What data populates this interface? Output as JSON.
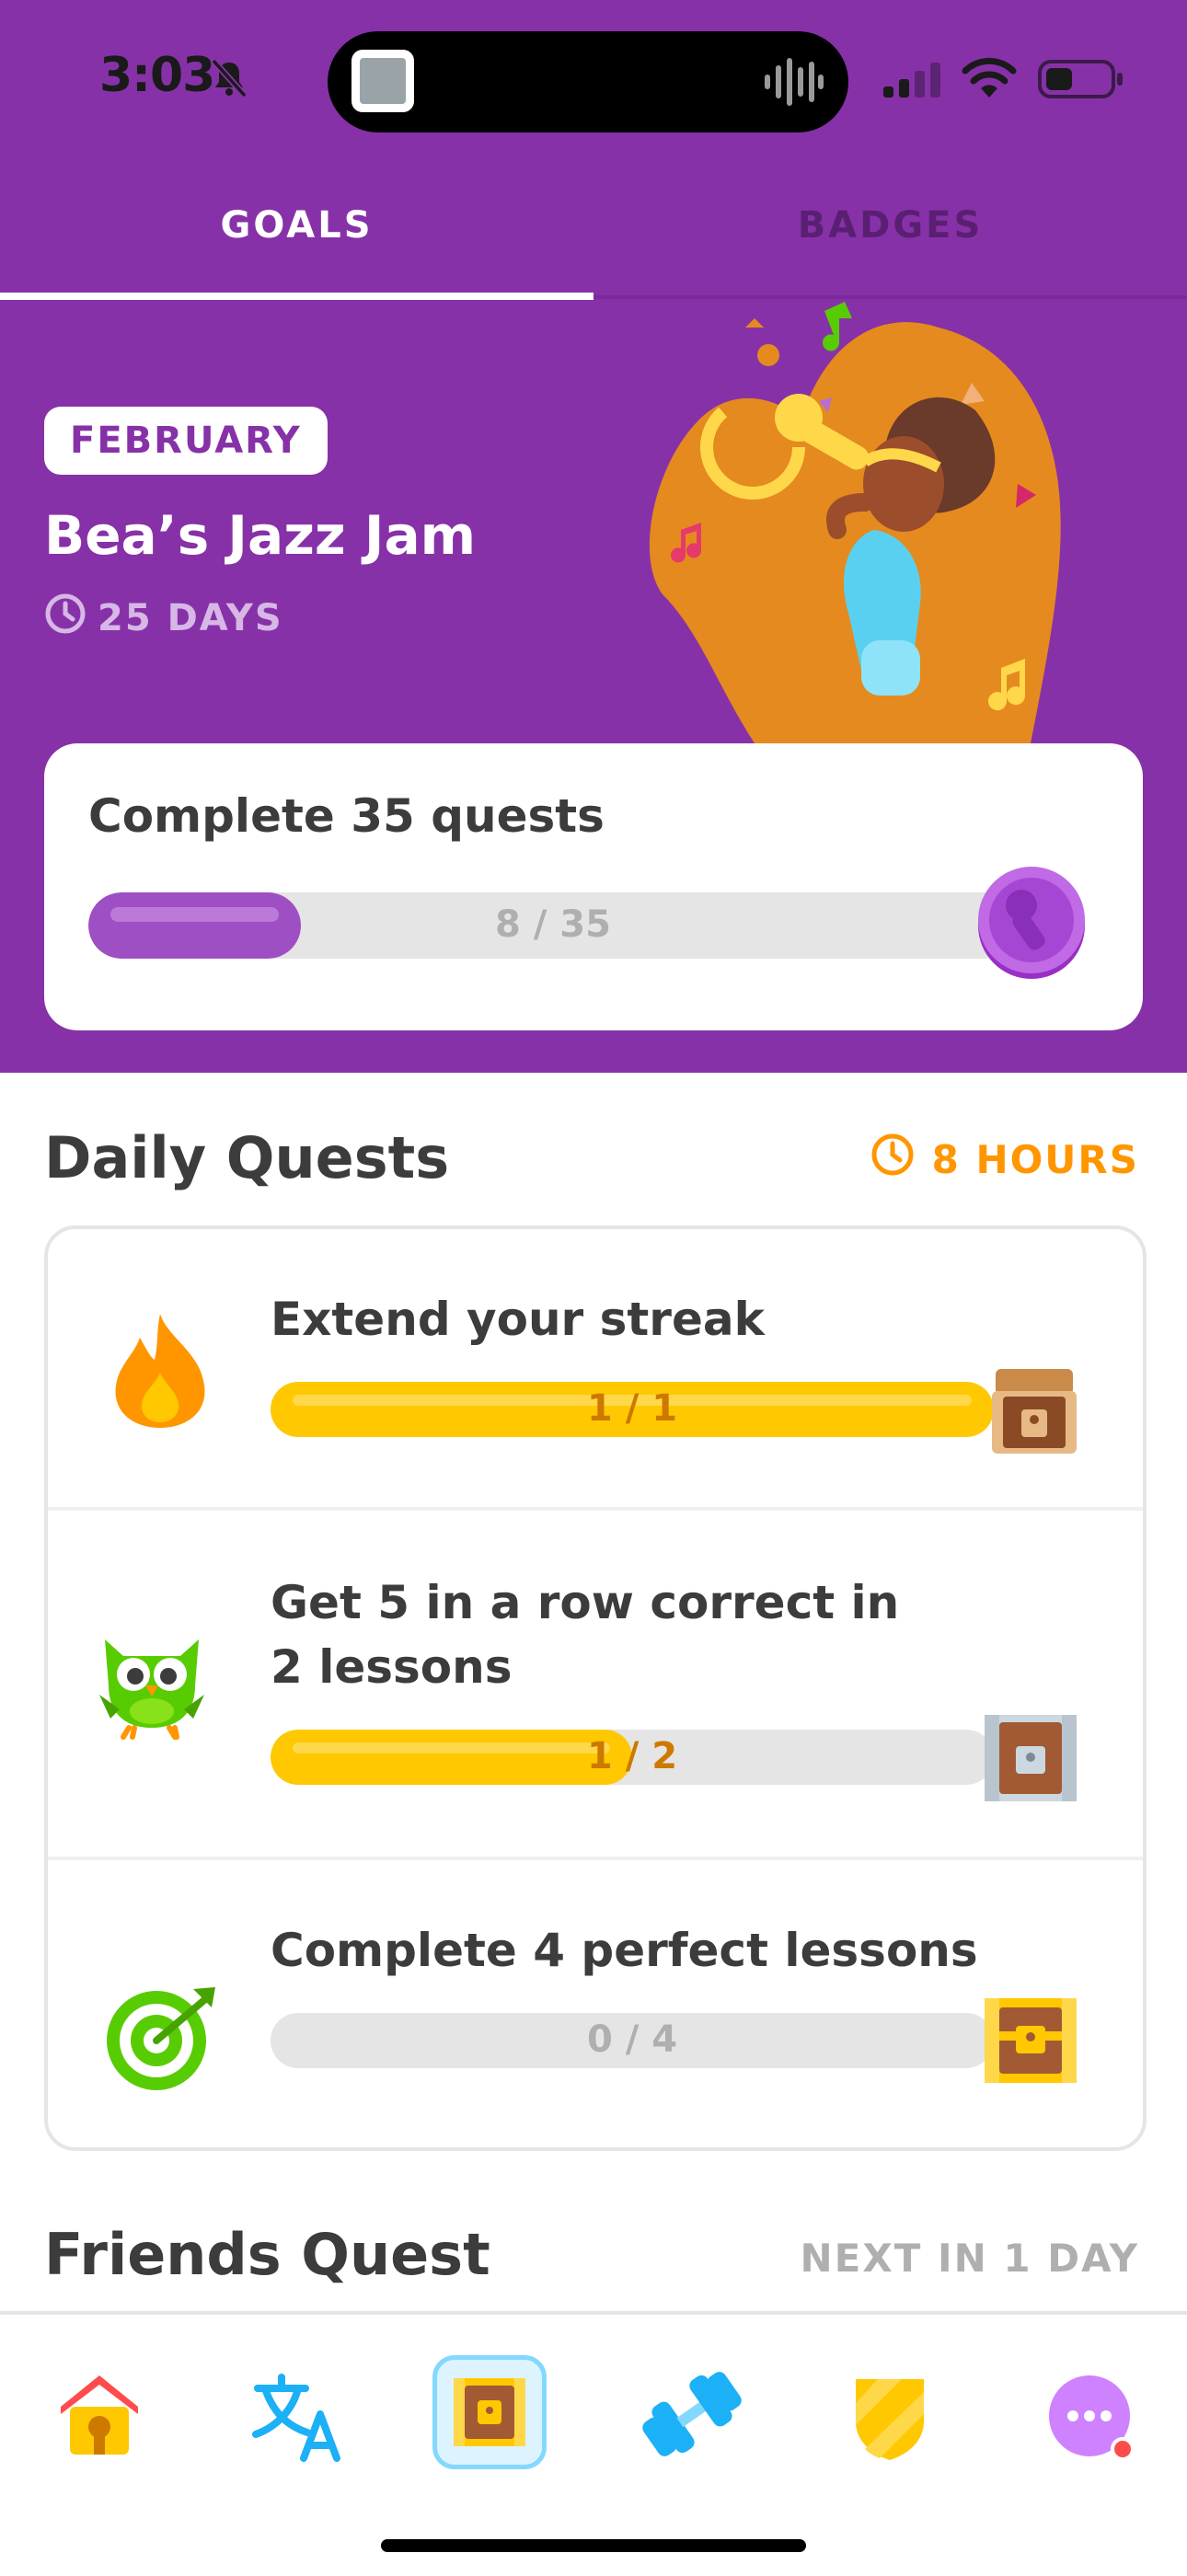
{
  "status_bar": {
    "time": "3:03"
  },
  "tabs": [
    {
      "label": "GOALS",
      "active": true
    },
    {
      "label": "BADGES",
      "active": false
    }
  ],
  "monthly": {
    "month": "FEBRUARY",
    "title": "Bea’s Jazz Jam",
    "remaining": "25 DAYS",
    "quest_title": "Complete 35 quests",
    "progress_text": "8 / 35",
    "progress": 0.2286
  },
  "daily": {
    "title": "Daily Quests",
    "remaining": "8 HOURS",
    "quests": [
      {
        "line1": "Extend your streak",
        "line2": "",
        "progress_text": "1 / 1",
        "progress": 1.0,
        "icon": "flame-icon",
        "reward": "opened-chest-icon"
      },
      {
        "line1": "Get 5 in a row correct in",
        "line2": "2 lessons",
        "progress_text": "1 / 2",
        "progress": 0.5,
        "icon": "owl-icon",
        "reward": "silver-chest-icon"
      },
      {
        "line1": "Complete 4 perfect lessons",
        "line2": "",
        "progress_text": "0 / 4",
        "progress": 0.0,
        "icon": "target-icon",
        "reward": "gold-chest-icon"
      }
    ]
  },
  "friends": {
    "title": "Friends Quest",
    "next": "NEXT IN 1 DAY"
  },
  "nav": [
    "home-icon",
    "translate-icon",
    "quests-chest-icon",
    "dumbbell-icon",
    "shield-icon",
    "more-icon"
  ],
  "colors": {
    "purple": "#8731a8",
    "gold": "#ffc800",
    "orange": "#ff9600",
    "grey": "#e5e5e5"
  }
}
